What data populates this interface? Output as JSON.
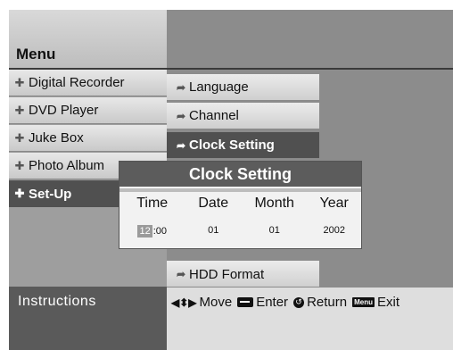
{
  "header": {
    "title": "Menu"
  },
  "left_menu": {
    "items": [
      {
        "label": "Digital Recorder",
        "icon": "plus-cross-icon",
        "selected": false
      },
      {
        "label": "DVD Player",
        "icon": "plus-cross-icon",
        "selected": false
      },
      {
        "label": "Juke Box",
        "icon": "plus-cross-icon",
        "selected": false
      },
      {
        "label": "Photo Album",
        "icon": "plus-cross-icon",
        "selected": false
      },
      {
        "label": "Set-Up",
        "icon": "plus-cross-icon",
        "selected": true
      }
    ]
  },
  "sub_menu": {
    "items": [
      {
        "label": "Language",
        "icon": "right-arrow-icon",
        "selected": false
      },
      {
        "label": "Channel",
        "icon": "right-arrow-icon",
        "selected": false
      },
      {
        "label": "Clock Setting",
        "icon": "right-arrow-icon",
        "selected": true
      },
      {
        "label": "HDD Format",
        "icon": "right-arrow-icon",
        "selected": false
      }
    ]
  },
  "dialog": {
    "title": "Clock Setting",
    "headers": {
      "time": "Time",
      "date": "Date",
      "month": "Month",
      "year": "Year"
    },
    "values": {
      "hour": "12",
      "minute": ":00",
      "date": "01",
      "month": "01",
      "year": "2002"
    }
  },
  "instructions": {
    "label": "Instructions",
    "move": "Move",
    "enter": "Enter",
    "return": "Return",
    "menu_key": "Menu",
    "exit": "Exit"
  },
  "colors": {
    "selected_bg": "#505050",
    "header_dark": "#8c8c8c",
    "instructions_bg": "#5a5a5a"
  }
}
